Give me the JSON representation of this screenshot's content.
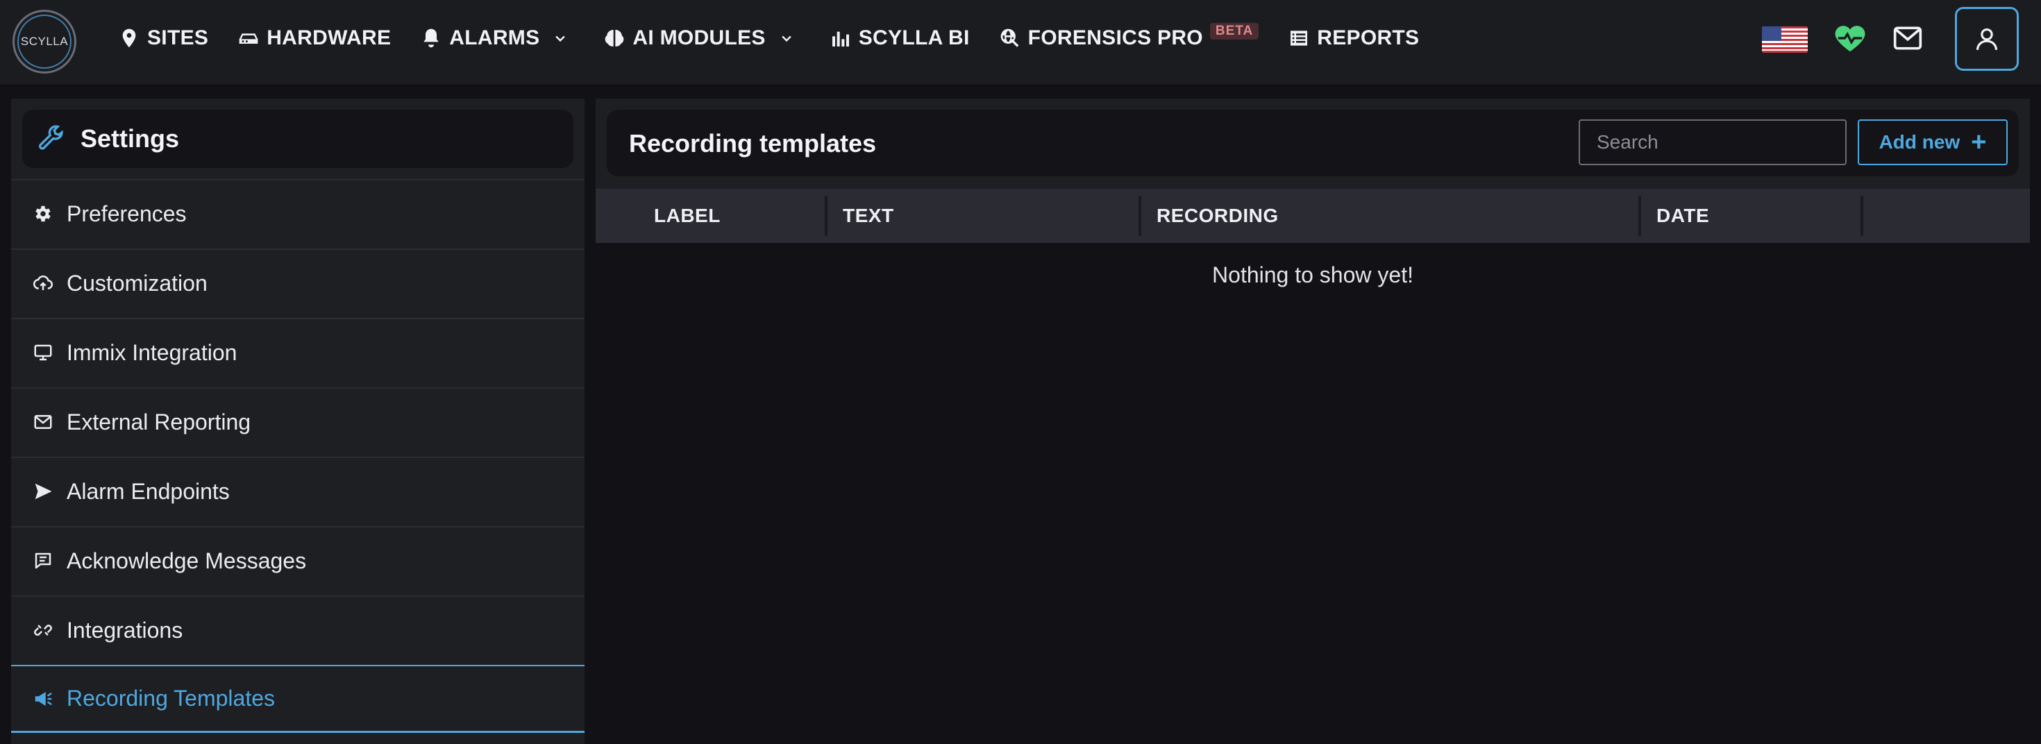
{
  "brand": {
    "logo_text": "SCYLLA"
  },
  "nav": {
    "items": [
      {
        "label": "SITES",
        "icon": "map-pin-icon",
        "dropdown": false
      },
      {
        "label": "HARDWARE",
        "icon": "hardware-icon",
        "dropdown": false
      },
      {
        "label": "ALARMS",
        "icon": "bell-icon",
        "dropdown": true
      },
      {
        "label": "AI MODULES",
        "icon": "brain-icon",
        "dropdown": true
      },
      {
        "label": "SCYLLA BI",
        "icon": "bar-chart-icon",
        "dropdown": false
      },
      {
        "label": "FORENSICS PRO",
        "icon": "globe-search-icon",
        "dropdown": false,
        "badge": "BETA"
      },
      {
        "label": "REPORTS",
        "icon": "report-list-icon",
        "dropdown": false
      }
    ]
  },
  "header_actions": {
    "language": "flag-us-icon",
    "health": "heartbeat-icon",
    "messages": "mail-icon",
    "account": "user-icon"
  },
  "sidebar": {
    "title": "Settings",
    "title_icon": "wrench-icon",
    "items": [
      {
        "label": "Preferences",
        "icon": "gear-icon"
      },
      {
        "label": "Customization",
        "icon": "cloud-upload-icon"
      },
      {
        "label": "Immix Integration",
        "icon": "monitor-icon"
      },
      {
        "label": "External Reporting",
        "icon": "envelope-icon"
      },
      {
        "label": "Alarm Endpoints",
        "icon": "send-icon"
      },
      {
        "label": "Acknowledge Messages",
        "icon": "message-icon"
      },
      {
        "label": "Integrations",
        "icon": "link-broken-icon"
      },
      {
        "label": "Recording Templates",
        "icon": "megaphone-icon",
        "active": true
      }
    ]
  },
  "main": {
    "title": "Recording templates",
    "search": {
      "placeholder": "Search",
      "value": ""
    },
    "add_button": "Add new",
    "table": {
      "columns": [
        "LABEL",
        "TEXT",
        "RECORDING",
        "DATE"
      ],
      "rows": [],
      "empty_message": "Nothing to show yet!"
    }
  },
  "colors": {
    "accent": "#4ea8e0",
    "background": "#121216",
    "panel": "#1e1f23",
    "heart": "#4cd47c",
    "beta_text": "#e08a8a"
  }
}
